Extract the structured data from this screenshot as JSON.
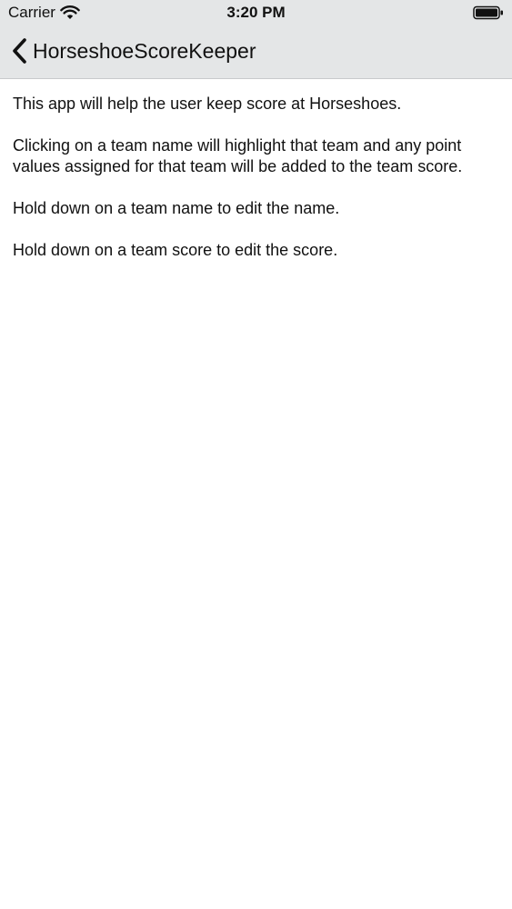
{
  "status_bar": {
    "carrier": "Carrier",
    "time": "3:20 PM",
    "wifi_icon": "wifi-icon",
    "battery_icon": "battery-icon"
  },
  "nav_bar": {
    "back_icon": "chevron-left-icon",
    "back_label": "HorseshoeScoreKeeper"
  },
  "content": {
    "paragraphs": [
      "This app will help the user keep score at Horseshoes.",
      "Clicking on a team name will highlight that team and any point values assigned for that team will be added to the team score.",
      "Hold down on a team name to edit the name.",
      "Hold down on a team score to edit the score."
    ]
  },
  "colors": {
    "nav_background": "#e4e6e7",
    "text": "#111111",
    "background": "#ffffff"
  }
}
